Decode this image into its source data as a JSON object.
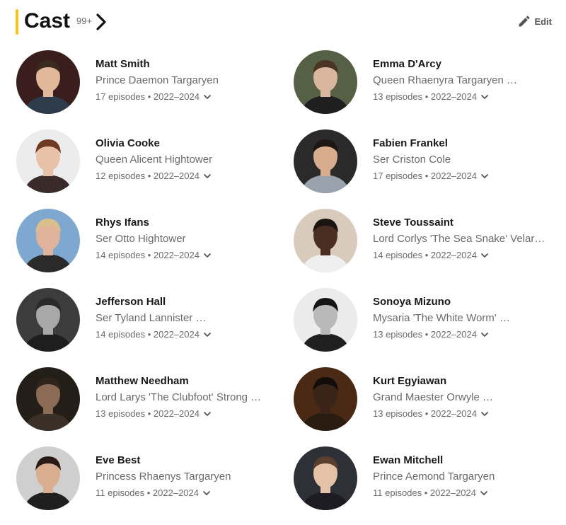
{
  "header": {
    "title": "Cast",
    "count": "99+",
    "edit_label": "Edit"
  },
  "colors": {
    "accent": "#f5c518"
  },
  "cast": [
    {
      "name": "Matt Smith",
      "role": "Prince Daemon Targaryen",
      "episodes": "17 episodes • 2022–2024",
      "truncated": false,
      "photo": {
        "bg": "#3a1d1d",
        "skin": "#e2b89b",
        "hair": "#3b2a1e",
        "cloth": "#2e3b4a"
      }
    },
    {
      "name": "Emma D'Arcy",
      "role": "Queen Rhaenyra Targaryen",
      "episodes": "13 episodes • 2022–2024",
      "truncated": true,
      "photo": {
        "bg": "#556045",
        "skin": "#d9b79e",
        "hair": "#4a3424",
        "cloth": "#1f1f1f"
      }
    },
    {
      "name": "Olivia Cooke",
      "role": "Queen Alicent Hightower",
      "episodes": "12 episodes • 2022–2024",
      "truncated": false,
      "photo": {
        "bg": "#ececec",
        "skin": "#e8c2a6",
        "hair": "#6e3a22",
        "cloth": "#3a2b2a"
      }
    },
    {
      "name": "Fabien Frankel",
      "role": "Ser Criston Cole",
      "episodes": "17 episodes • 2022–2024",
      "truncated": false,
      "photo": {
        "bg": "#2a2a2a",
        "skin": "#d7ad8e",
        "hair": "#1e1713",
        "cloth": "#9aa3ad"
      }
    },
    {
      "name": "Rhys Ifans",
      "role": "Ser Otto Hightower",
      "episodes": "14 episodes • 2022–2024",
      "truncated": false,
      "photo": {
        "bg": "#7fa8d0",
        "skin": "#e0b39a",
        "hair": "#d9c08a",
        "cloth": "#2a2a2a"
      }
    },
    {
      "name": "Steve Toussaint",
      "role": "Lord Corlys 'The Sea Snake' Velaryon",
      "episodes": "14 episodes • 2022–2024",
      "truncated": false,
      "photo": {
        "bg": "#d9cbbb",
        "skin": "#4a2e22",
        "hair": "#1a1412",
        "cloth": "#efefef"
      }
    },
    {
      "name": "Jefferson Hall",
      "role": "Ser Tyland Lannister",
      "episodes": "14 episodes • 2022–2024",
      "truncated": true,
      "photo": {
        "bg": "#3c3c3c",
        "skin": "#a8a8a8",
        "hair": "#2a2a2a",
        "cloth": "#1e1e1e"
      }
    },
    {
      "name": "Sonoya Mizuno",
      "role": "Mysaria 'The White Worm'",
      "episodes": "13 episodes • 2022–2024",
      "truncated": true,
      "photo": {
        "bg": "#ebebeb",
        "skin": "#b9b9b9",
        "hair": "#151515",
        "cloth": "#202020"
      }
    },
    {
      "name": "Matthew Needham",
      "role": "Lord Larys 'The Clubfoot' Strong",
      "episodes": "13 episodes • 2022–2024",
      "truncated": true,
      "photo": {
        "bg": "#241e19",
        "skin": "#8c6b55",
        "hair": "#2e241c",
        "cloth": "#3a3028"
      }
    },
    {
      "name": "Kurt Egyiawan",
      "role": "Grand Maester Orwyle",
      "episodes": "13 episodes • 2022–2024",
      "truncated": true,
      "photo": {
        "bg": "#4a2a14",
        "skin": "#3a2418",
        "hair": "#120d0a",
        "cloth": "#2b1c12"
      }
    },
    {
      "name": "Eve Best",
      "role": "Princess Rhaenys Targaryen",
      "episodes": "11 episodes • 2022–2024",
      "truncated": false,
      "photo": {
        "bg": "#cfcfcf",
        "skin": "#d9ae90",
        "hair": "#2a1c14",
        "cloth": "#1f1f1f"
      }
    },
    {
      "name": "Ewan Mitchell",
      "role": "Prince Aemond Targaryen",
      "episodes": "11 episodes • 2022–2024",
      "truncated": false,
      "photo": {
        "bg": "#2e3038",
        "skin": "#e3c2a8",
        "hair": "#5a3f2e",
        "cloth": "#1c1c22"
      }
    }
  ]
}
